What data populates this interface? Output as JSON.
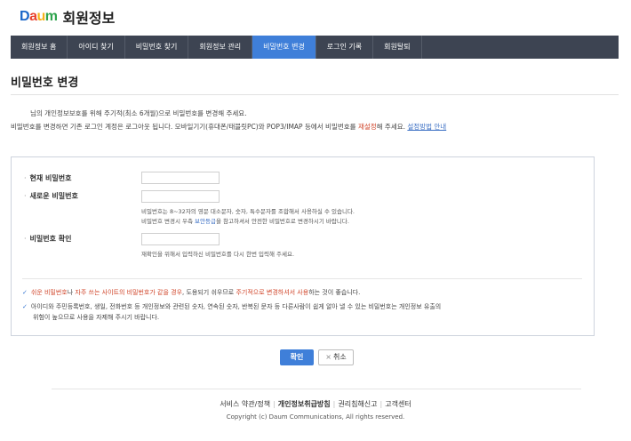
{
  "brand": {
    "logo_letters": [
      {
        "char": "D",
        "color": "#1a66c8"
      },
      {
        "char": "a",
        "color": "#e8422e"
      },
      {
        "char": "u",
        "color": "#f5b21b"
      },
      {
        "char": "m",
        "color": "#2fa34d"
      }
    ],
    "site_title": "회원정보"
  },
  "nav": {
    "items": [
      {
        "label": "회원정보 홈",
        "active": false
      },
      {
        "label": "아이디 찾기",
        "active": false
      },
      {
        "label": "비밀번호 찾기",
        "active": false
      },
      {
        "label": "회원정보 관리",
        "active": false
      },
      {
        "label": "비밀번호 변경",
        "active": true
      },
      {
        "label": "로그인 기록",
        "active": false
      },
      {
        "label": "회원탈퇴",
        "active": false
      }
    ]
  },
  "page": {
    "title": "비밀번호 변경",
    "intro_line1": "님의 개인정보보호를 위해 주기적(최소 6개월)으로 비밀번호를 변경해 주세요.",
    "intro_line2_a": "비밀번호를 변경하면 기존 로그인 계정은 로그아웃 됩니다. 모바일기기(휴대폰/태블릿PC)와 POP3/IMAP 등에서 비밀번호를 ",
    "intro_line2_red": "재설정",
    "intro_line2_b": "해 주세요. ",
    "intro_link": "설정방법 안내"
  },
  "form": {
    "current_label": "현재 비밀번호",
    "new_label": "새로운 비밀번호",
    "confirm_label": "비밀번호 확인",
    "new_help_1": "비밀번호는 8~32자의 영문 대소문자, 숫자, 특수문자를 조합해서 사용하실 수 있습니다.",
    "new_help_2a": "비밀번호 변경시 우측 ",
    "new_help_2_link": "보안등급",
    "new_help_2b": "을 참고하셔서 안전한 비밀번호로 변경하시기 바랍니다.",
    "confirm_help": "재확인을 위해서 입력하신 비밀번호를 다시 한번 입력해 주세요."
  },
  "notes": {
    "note1_red1": "쉬운 비밀번호",
    "note1_a": "나 ",
    "note1_red2": "자주 쓰는 사이트의 비밀번호가 같을 경우",
    "note1_b": ", 도용되기 쉬우므로 ",
    "note1_red3": "주기적으로 변경하셔서 사용",
    "note1_c": "하는 것이 좋습니다.",
    "note2_line1": "아이디와 주민등록번호, 생일, 전화번호 등 개인정보와 관련된 숫자, 연속된 숫자, 반복된 문자 등 다른사람이 쉽게 알아 낼 수 있는 비밀번호는 개인정보 유출의",
    "note2_line2": "위험이 높으므로 사용을 자제해 주시기 바랍니다."
  },
  "buttons": {
    "ok": "확인",
    "cancel_x": "×",
    "cancel": "취소"
  },
  "footer": {
    "link1": "서비스 약관/정책",
    "link2": "개인정보취급방침",
    "link3": "권리침해신고",
    "link4": "고객센터",
    "separator": "|",
    "copyright": "Copyright (c) Daum Communications, All rights reserved."
  }
}
